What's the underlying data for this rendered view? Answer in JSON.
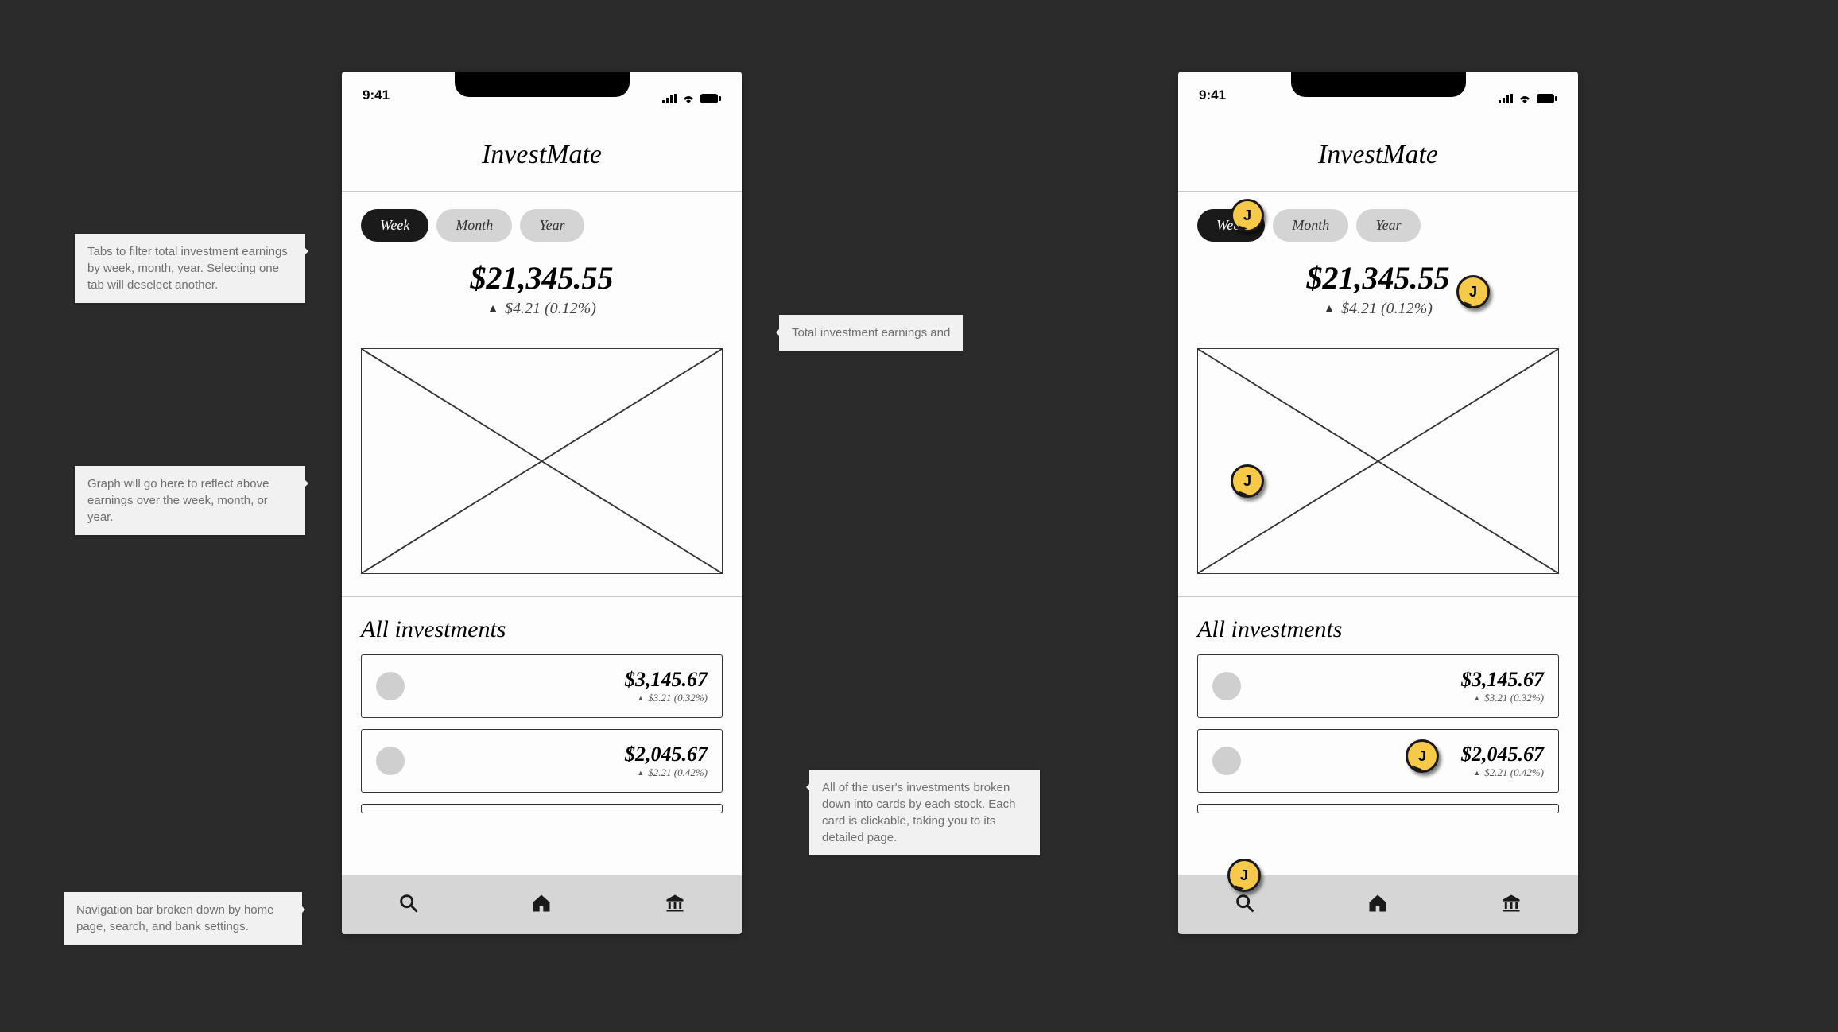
{
  "status": {
    "time": "9:41"
  },
  "app": {
    "title": "InvestMate"
  },
  "tabs": {
    "week": "Week",
    "month": "Month",
    "year": "Year"
  },
  "earnings": {
    "total": "$21,345.55",
    "delta": "$4.21 (0.12%)"
  },
  "section": {
    "all_investments": "All investments"
  },
  "investments": [
    {
      "price": "$3,145.67",
      "delta": "$3.21 (0.32%)"
    },
    {
      "price": "$2,045.67",
      "delta": "$2.21 (0.42%)"
    }
  ],
  "annotations": {
    "tabs": "Tabs to filter total investment earnings by week, month, year. Selecting one tab will deselect another.",
    "total": "Total investment earnings and",
    "graph": "Graph will go here to reflect above earnings over the week, month, or year.",
    "cards": "All of the user's investments broken down into cards by each stock. Each card is clickable, taking you to its detailed page.",
    "nav": "Navigation bar broken down by home page, search, and bank settings."
  },
  "pin_label": "J"
}
